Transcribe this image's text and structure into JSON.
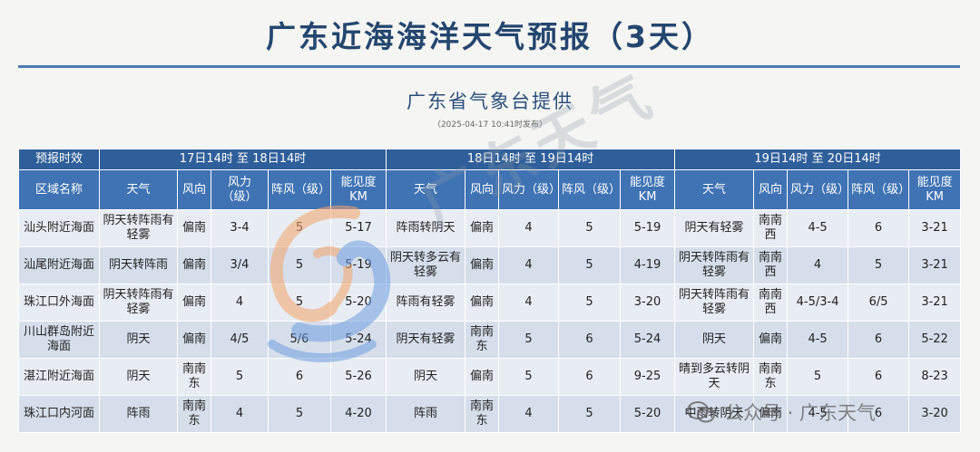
{
  "title": "广东近海海洋天气预报（3天）",
  "subtitle": "广东省气象台提供",
  "issue_time": "（2025-04-17  10:41时发布）",
  "watermark_text": "广东天气",
  "footer_watermark": "公众号 · 广东天气",
  "colors": {
    "title": "#24466f",
    "header_dark": "#2f5f9a",
    "header": "#3f73b4",
    "row_light": "#e8ecf3",
    "row_dark": "#d6deeb"
  },
  "table": {
    "period_label": "预报时效",
    "periods": [
      "17日14时 至 18日14时",
      "18日14时 至 19日14时",
      "19日14时 至 20日14时"
    ],
    "region_header": "区域名称",
    "col_headers": [
      "天气",
      "风向",
      "风力（级）",
      "阵风（级）",
      "能见度KM"
    ],
    "rows": [
      {
        "region": "汕头附近海面",
        "d": [
          [
            "阴天转阵雨有轻雾",
            "偏南",
            "3-4",
            "5",
            "5-17"
          ],
          [
            "阵雨转阴天",
            "偏南",
            "4",
            "5",
            "5-19"
          ],
          [
            "阴天有轻雾",
            "南南西",
            "4-5",
            "6",
            "3-21"
          ]
        ]
      },
      {
        "region": "汕尾附近海面",
        "d": [
          [
            "阴天转阵雨",
            "偏南",
            "3/4",
            "5",
            "5-19"
          ],
          [
            "阴天转多云有轻雾",
            "偏南",
            "4",
            "5",
            "4-19"
          ],
          [
            "阴天转阵雨有轻雾",
            "南南西",
            "4",
            "5",
            "3-21"
          ]
        ]
      },
      {
        "region": "珠江口外海面",
        "d": [
          [
            "阴天转阵雨有轻雾",
            "偏南",
            "4",
            "5",
            "5-20"
          ],
          [
            "阵雨有轻雾",
            "偏南",
            "4",
            "5",
            "3-20"
          ],
          [
            "阴天转阵雨有轻雾",
            "南南西",
            "4-5/3-4",
            "6/5",
            "3-21"
          ]
        ]
      },
      {
        "region": "川山群岛附近海面",
        "d": [
          [
            "阴天",
            "偏南",
            "4/5",
            "5/6",
            "5-24"
          ],
          [
            "阴天有轻雾",
            "南南东",
            "5",
            "6",
            "5-24"
          ],
          [
            "阴天",
            "偏南",
            "4-5",
            "6",
            "5-22"
          ]
        ]
      },
      {
        "region": "湛江附近海面",
        "d": [
          [
            "阴天",
            "南南东",
            "5",
            "6",
            "5-26"
          ],
          [
            "阴天",
            "偏南",
            "5",
            "6",
            "9-25"
          ],
          [
            "晴到多云转阴天",
            "南南东",
            "5",
            "6",
            "8-23"
          ]
        ]
      },
      {
        "region": "珠江口内河面",
        "d": [
          [
            "阵雨",
            "南南东",
            "4",
            "5",
            "4-20"
          ],
          [
            "阵雨",
            "南南东",
            "4",
            "5",
            "5-20"
          ],
          [
            "中雨转阴天",
            "偏南",
            "4-5",
            "6",
            "3-20"
          ]
        ]
      }
    ]
  }
}
